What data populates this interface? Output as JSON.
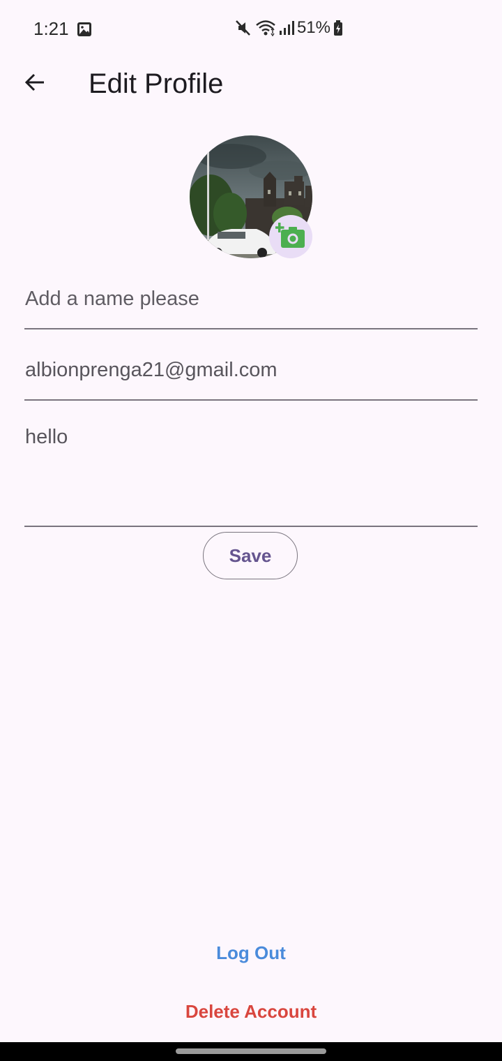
{
  "status_bar": {
    "time": "1:21",
    "battery": "51%",
    "icons": [
      "gallery-icon",
      "mute-icon",
      "wifi-icon",
      "signal-icon",
      "battery-icon"
    ]
  },
  "app_bar": {
    "title": "Edit Profile",
    "back_icon": "arrow-left-icon"
  },
  "avatar": {
    "badge_icon": "add-photo-icon",
    "badge_color": "#4caf50",
    "badge_bg": "#e9ddf6"
  },
  "form": {
    "name_placeholder": "Add a name please",
    "email_value": "albionprenga21@gmail.com",
    "bio_value": "hello",
    "save_label": "Save"
  },
  "actions": {
    "logout_label": "Log Out",
    "delete_label": "Delete Account"
  },
  "colors": {
    "background": "#fdf7fd",
    "primary": "#65558f",
    "logout": "#4a8bdb",
    "delete": "#d9463e",
    "outline": "#79747e"
  }
}
